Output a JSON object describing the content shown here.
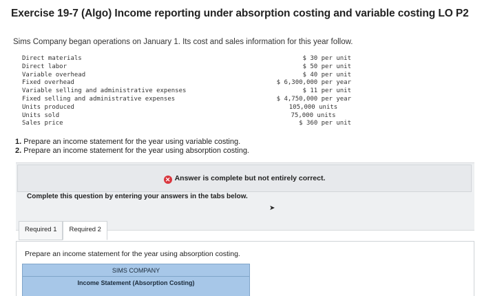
{
  "title": "Exercise 19-7 (Algo) Income reporting under absorption costing and variable costing LO P2",
  "intro": "Sims Company began operations on January 1. Its cost and sales information for this year follow.",
  "data_rows": [
    {
      "label": "Direct materials",
      "value": "$ 30 per unit"
    },
    {
      "label": "Direct labor",
      "value": "$ 50 per unit"
    },
    {
      "label": "Variable overhead",
      "value": "$ 40 per unit"
    },
    {
      "label": "Fixed overhead",
      "value": "$ 6,300,000 per year"
    },
    {
      "label": "Variable selling and administrative expenses",
      "value": "$ 11 per unit"
    },
    {
      "label": "Fixed selling and administrative expenses",
      "value": "$ 4,750,000 per year"
    },
    {
      "label": "Units produced",
      "value": "105,000 units"
    },
    {
      "label": "Units sold",
      "value": "75,000 units"
    },
    {
      "label": "Sales price",
      "value": "$ 360 per unit"
    }
  ],
  "tasks": [
    {
      "num": "1.",
      "text": "Prepare an income statement for the year using variable costing."
    },
    {
      "num": "2.",
      "text": "Prepare an income statement for the year using absorption costing."
    }
  ],
  "status_message": "Answer is complete but not entirely correct.",
  "instruction": "Complete this question by entering your answers in the tabs below.",
  "tabs": [
    {
      "label": "Required 1",
      "active": false
    },
    {
      "label": "Required 2",
      "active": true
    }
  ],
  "prompt": "Prepare an income statement for the year using absorption costing.",
  "statement": {
    "company": "SIMS COMPANY",
    "title": "Income Statement (Absorption Costing)"
  }
}
